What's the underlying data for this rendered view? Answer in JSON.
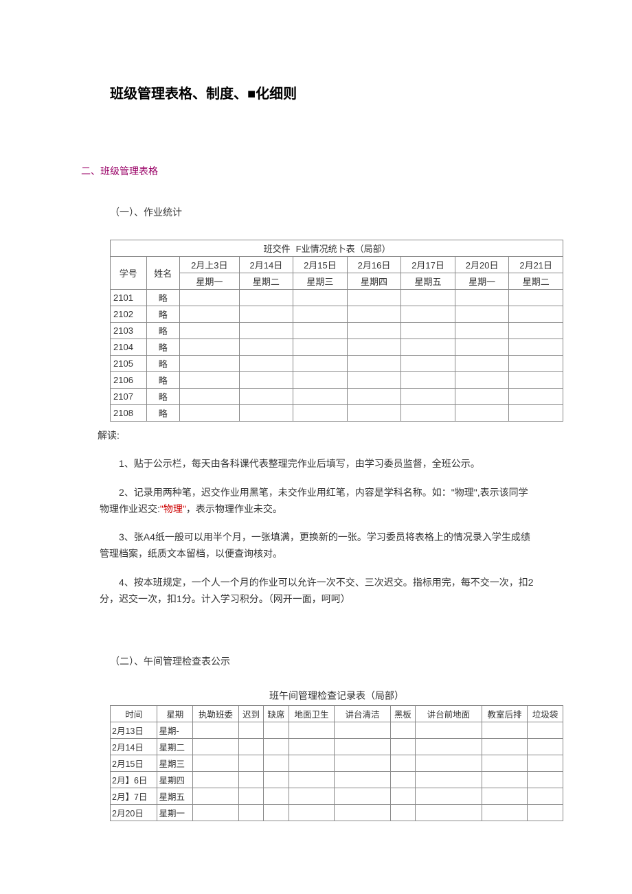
{
  "title": "班级管理表格、制度、■化细则",
  "sectionHeader": "二、班级管理表格",
  "sub1": "（一）、作业统计",
  "table1": {
    "captionLeft": "班交件",
    "captionRight": "F业情况统卜表（局部）",
    "idHeader": "学号",
    "nameHeader": "姓名",
    "dates": [
      "2月上3日",
      "2月14日",
      "2月15日",
      "2月16日",
      "2月17日",
      "2月20日",
      "2月21日"
    ],
    "weekdays": [
      "星期一",
      "星期二",
      "星期三",
      "星期四",
      "星期五",
      "星期一",
      "星期二"
    ],
    "rows": [
      {
        "id": "2101",
        "name": "略"
      },
      {
        "id": "2102",
        "name": "略"
      },
      {
        "id": "2103",
        "name": "略"
      },
      {
        "id": "2104",
        "name": "略"
      },
      {
        "id": "2105",
        "name": "略"
      },
      {
        "id": "2106",
        "name": "略"
      },
      {
        "id": "2107",
        "name": "略"
      },
      {
        "id": "2108",
        "name": "略"
      }
    ]
  },
  "interpretLabel": "解读:",
  "paras": {
    "p1": "1、贴于公示栏，每天由各科课代表整理完作业后填写，由学习委员监督，全班公示。",
    "p2a": "2、记录用两种笔，迟交作业用黑笔，未交作业用红笔，内容是学科名称。如：\"物理\",表示该同学物理作业迟交:",
    "p2red": "\"物理\"",
    "p2b": "，表示物理作业未交。",
    "p3": "3、张A4纸一般可以用半个月，一张填满，更换新的一张。学习委员将表格上的情况录入学生成绩管理档案，纸质文本留档，以便查询核对。",
    "p4": "4、按本班规定，一个人一个月的作业可以允许一次不交、三次迟交。指标用完，每不交一次，扣2分，迟交一次，扣1分。计入学习积分。（网开一面，呵呵）"
  },
  "sub2": "（二）、午间管理检查表公示",
  "table2": {
    "caption": "班午间管理检查记录表（局部）",
    "headers": [
      "时间",
      "星期",
      "执勒班委",
      "迟到",
      "缺席",
      "地面卫生",
      "讲台清洁",
      "黑板",
      "讲台前地面",
      "教室后排",
      "垃圾袋"
    ],
    "rows": [
      {
        "date": "2月13日",
        "wd": "星期-"
      },
      {
        "date": "2月14日",
        "wd": "星期二"
      },
      {
        "date": "2月15日",
        "wd": "星期三"
      },
      {
        "date": "2月】6日",
        "wd": "星期四"
      },
      {
        "date": "2月】7日",
        "wd": "星期五"
      },
      {
        "date": "2月20日",
        "wd": "星期一"
      }
    ]
  }
}
